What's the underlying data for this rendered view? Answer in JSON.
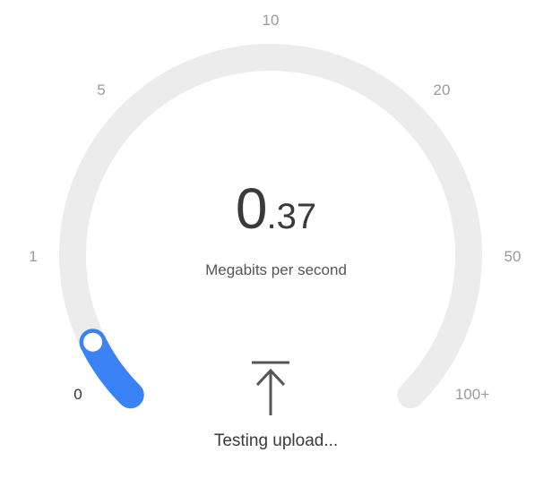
{
  "gauge": {
    "scale_labels": [
      "0",
      "1",
      "5",
      "10",
      "20",
      "50",
      "100+"
    ],
    "min_label": "0",
    "max_label": "100+",
    "track_color": "#ececec",
    "fill_color": "#3b82f6",
    "knob_color": "#ffffff",
    "progress_fraction": 0.07
  },
  "readout": {
    "integer": "0",
    "decimal": ".37",
    "unit": "Megabits per second"
  },
  "status": {
    "icon": "upload-arrow-icon",
    "text": "Testing upload..."
  }
}
